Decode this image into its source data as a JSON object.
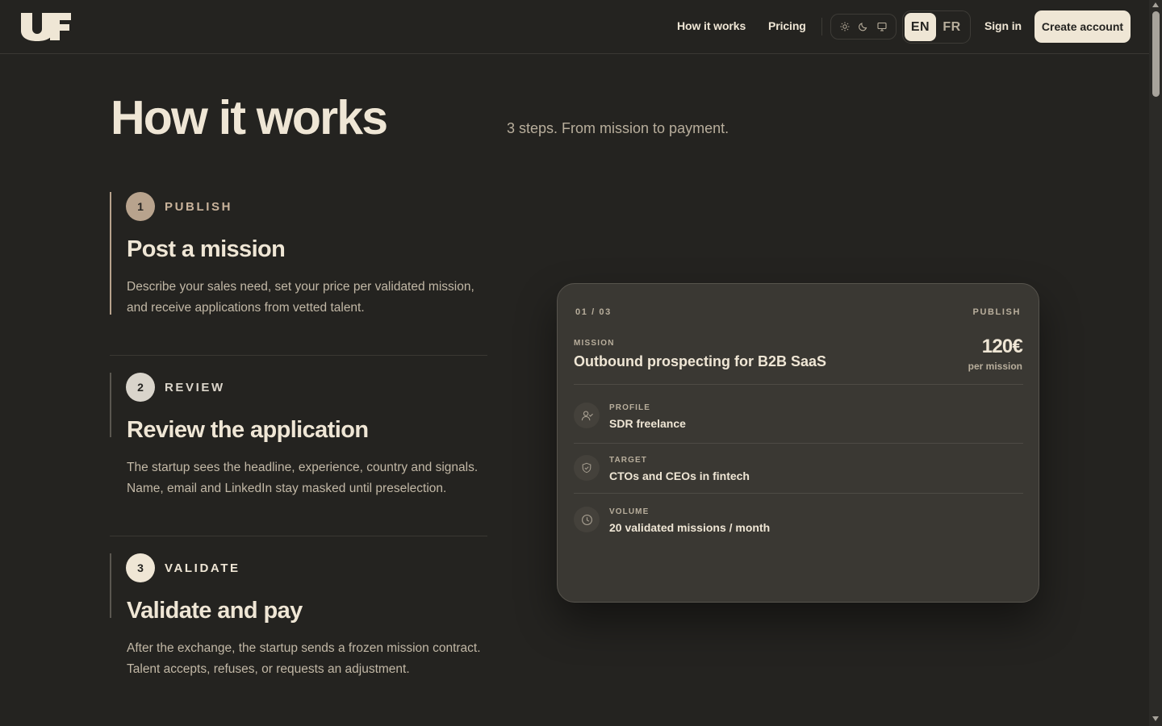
{
  "header": {
    "logo_text": "UF",
    "nav": [
      {
        "label": "How it works"
      },
      {
        "label": "Pricing"
      }
    ],
    "theme_options": [
      "sun-icon",
      "moon-icon",
      "monitor-icon"
    ],
    "languages": [
      {
        "label": "EN",
        "active": true
      },
      {
        "label": "FR",
        "active": false
      }
    ],
    "sign_in": "Sign in",
    "create_account": "Create account"
  },
  "page": {
    "title": "How it works",
    "subtitle": "3 steps. From mission to payment."
  },
  "steps": [
    {
      "number": "1",
      "kicker": "PUBLISH",
      "title": "Post a mission",
      "description": "Describe your sales need, set your price per validated mission, and receive applications from vetted talent.",
      "active": true
    },
    {
      "number": "2",
      "kicker": "REVIEW",
      "title": "Review the application",
      "description": "The startup sees the headline, experience, country and signals. Name, email and LinkedIn stay masked until preselection.",
      "active": false
    },
    {
      "number": "3",
      "kicker": "VALIDATE",
      "title": "Validate and pay",
      "description": "After the exchange, the startup sends a frozen mission contract. Talent accepts, refuses, or requests an adjustment.",
      "active": false
    }
  ],
  "card": {
    "counter": "01 / 03",
    "stage": "PUBLISH",
    "mission_label": "MISSION",
    "mission_title": "Outbound prospecting for B2B SaaS",
    "price": "120€",
    "price_unit": "per mission",
    "rows": [
      {
        "icon": "user-icon",
        "label": "PROFILE",
        "value": "SDR freelance"
      },
      {
        "icon": "shield-icon",
        "label": "TARGET",
        "value": "CTOs and CEOs in fintech"
      },
      {
        "icon": "clock-icon",
        "label": "VOLUME",
        "value": "20 validated missions / month"
      }
    ]
  },
  "colors": {
    "background": "#242320",
    "text": "#efe6d5",
    "muted": "#b8ae9c",
    "step1_accent": "#b8a38d",
    "step2_accent": "#d9d4cb",
    "step3_accent": "#efe6d5",
    "card_bg": "#3a3833"
  }
}
